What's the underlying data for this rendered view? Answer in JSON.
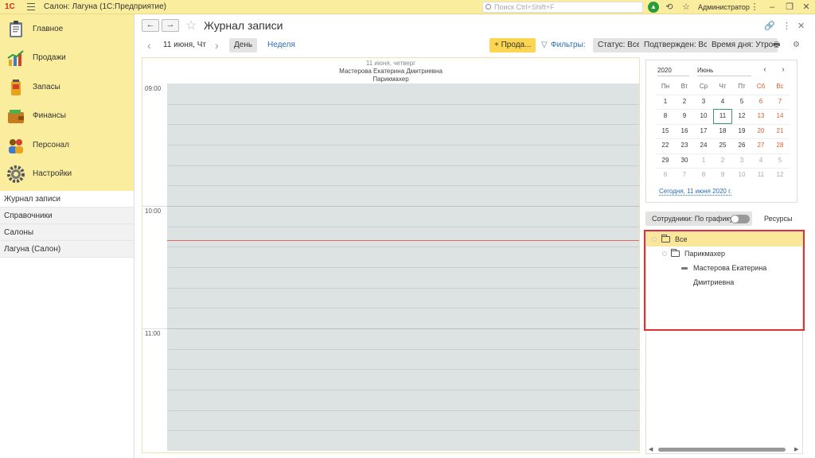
{
  "titlebar": {
    "logo": "1С",
    "app_title": "Салон: Лагуна  (1С:Предприятие)",
    "search_placeholder": "Поиск Ctrl+Shift+F",
    "user": "Администратор"
  },
  "sidebar": {
    "sections": [
      {
        "label": "Главное",
        "icon": "clipboard-icon"
      },
      {
        "label": "Продажи",
        "icon": "sales-chart-icon"
      },
      {
        "label": "Запасы",
        "icon": "inventory-icon"
      },
      {
        "label": "Финансы",
        "icon": "wallet-icon"
      },
      {
        "label": "Персонал",
        "icon": "people-icon"
      },
      {
        "label": "Настройки",
        "icon": "gear-icon"
      }
    ],
    "links": [
      "Журнал записи",
      "Справочники",
      "Салоны",
      "Лагуна (Салон)"
    ]
  },
  "form": {
    "title": "Журнал записи",
    "date": "11 июня, Чт",
    "view_day": "День",
    "view_week": "Неделя",
    "sell_button": "+ Прода...",
    "filters_label": "Фильтры:",
    "status": "Статус: Все",
    "confirmed": "Подтвержден: Все",
    "time_of_day": "Время дня: Утро"
  },
  "schedule": {
    "date_line": "11 июня, четверг",
    "employee": "Мастерова Екатерина Дмитриевна",
    "position": "Парикмахер",
    "times": [
      "09:00",
      "10:00",
      "11:00"
    ],
    "now_fraction": 0.64
  },
  "calendar": {
    "year": "2020",
    "month": "Июнь",
    "weekdays": [
      "Пн",
      "Вт",
      "Ср",
      "Чт",
      "Пт",
      "Сб",
      "Вс"
    ],
    "weeks": [
      [
        "1",
        "2",
        "3",
        "4",
        "5",
        "6",
        "7"
      ],
      [
        "8",
        "9",
        "10",
        "11",
        "12",
        "13",
        "14"
      ],
      [
        "15",
        "16",
        "17",
        "18",
        "19",
        "20",
        "21"
      ],
      [
        "22",
        "23",
        "24",
        "25",
        "26",
        "27",
        "28"
      ],
      [
        "29",
        "30",
        "1",
        "2",
        "3",
        "4",
        "5"
      ],
      [
        "6",
        "7",
        "8",
        "9",
        "10",
        "11",
        "12"
      ]
    ],
    "today": "11",
    "today_link": "Сегодня, 11 июня 2020 г."
  },
  "employees": {
    "tab_label": "Сотрудники: По графику",
    "resources_label": "Ресурсы",
    "tree": [
      {
        "label": "Все",
        "level": 0,
        "type": "folder",
        "selected": true
      },
      {
        "label": "Парикмахер",
        "level": 1,
        "type": "folder",
        "selected": false
      },
      {
        "label": "Мастерова Екатерина Дмитриевна",
        "level": 2,
        "type": "item",
        "selected": false
      }
    ]
  },
  "colors": {
    "accent_yellow": "#fbed9e",
    "button_yellow": "#fcd650",
    "weekend": "#e45c2a",
    "highlight_border": "#e03030"
  }
}
